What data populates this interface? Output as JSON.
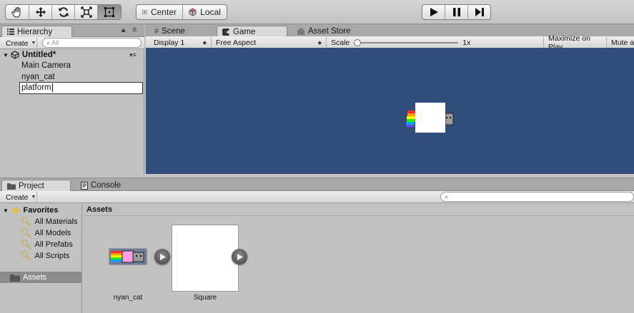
{
  "toolbar": {
    "tools": [
      "hand-tool",
      "move-tool",
      "rotate-tool",
      "scale-tool",
      "rect-tool"
    ],
    "pivot_mode": "Center",
    "pivot_rotation": "Local"
  },
  "hierarchy": {
    "tab_label": "Hierarchy",
    "create_label": "Create",
    "search_placeholder": "All",
    "scene_name": "Untitled*",
    "items": [
      "Main Camera",
      "nyan_cat"
    ],
    "editing_value": "platform"
  },
  "center_tabs": {
    "scene": "Scene",
    "game": "Game",
    "asset_store": "Asset Store"
  },
  "game_toolbar": {
    "display": "Display 1",
    "aspect": "Free Aspect",
    "scale_label": "Scale",
    "scale_value": "1x",
    "scale_level": 0,
    "maximize": "Maximize on Play",
    "mute": "Mute aud"
  },
  "bottom_tabs": {
    "project": "Project",
    "console": "Console"
  },
  "project": {
    "create_label": "Create",
    "favorites_label": "Favorites",
    "favorites": [
      "All Materials",
      "All Models",
      "All Prefabs",
      "All Scripts"
    ],
    "assets_folder": "Assets",
    "breadcrumb": "Assets",
    "assets": [
      {
        "name": "nyan_cat"
      },
      {
        "name": "Square"
      }
    ]
  },
  "colors": {
    "game_background": "#314d79",
    "selection": "#8c8c8c"
  }
}
